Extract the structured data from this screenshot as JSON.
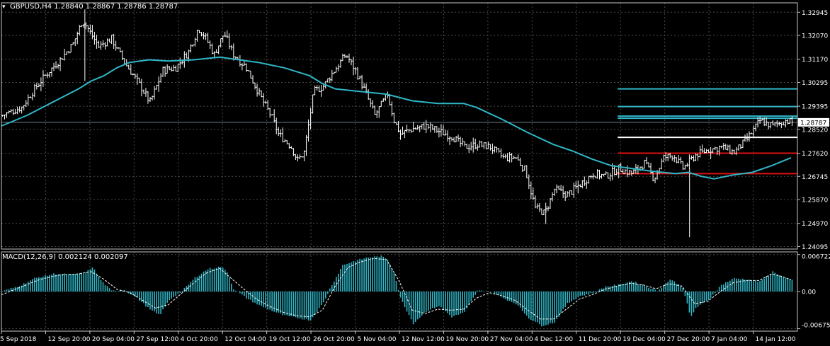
{
  "colors": {
    "background": "#000000",
    "grid": "#4a4a4a",
    "frame": "#c8c8c8",
    "price_bars": "#ffffff",
    "moving_average": "#2fb6c6",
    "macd_histogram": "#2fb6c6",
    "macd_signal": "#ffffff",
    "level_cyan": "#2fb6c6",
    "level_white": "#ffffff",
    "level_red": "#e01010",
    "current_price_line": "#708090",
    "text": "#ffffff"
  },
  "header": {
    "menu_glyph": "▾",
    "title": "GBPUSD,H4  1.28840 1.28867 1.28786 1.28787",
    "macd_title": "MACD(12,26,9) 0.002124 0.002097"
  },
  "chart_data": [
    {
      "type": "bar",
      "name": "GBPUSD,H4",
      "ylim": [
        1.24,
        1.333
      ],
      "y_ticks": [
        1.32945,
        1.3207,
        1.3117,
        1.30295,
        1.29395,
        1.2852,
        1.2762,
        1.26745,
        1.2587,
        1.2497,
        1.24095
      ],
      "y_tick_labels": [
        "1.32945",
        "1.32070",
        "1.31170",
        "1.30295",
        "1.29395",
        "1.28520",
        "1.27620",
        "1.26745",
        "1.25870",
        "1.24970",
        "1.24095"
      ],
      "last_price": 1.28787,
      "last_price_label": "1.28787",
      "x_labels": [
        "5 Sep 2018",
        "12 Sep 20:00",
        "20 Sep 04:00",
        "27 Sep 12:00",
        "4 Oct 20:00",
        "12 Oct 04:00",
        "19 Oct 12:00",
        "26 Oct 20:00",
        "5 Nov 04:00",
        "12 Nov 12:00",
        "19 Nov 20:00",
        "27 Nov 04:00",
        "4 Dec 12:00",
        "11 Dec 20:00",
        "19 Dec 04:00",
        "27 Dec 20:00",
        "7 Jan 04:00",
        "14 Jan 12:00"
      ],
      "close_path": [
        [
          0,
          1.2905
        ],
        [
          3,
          1.2935
        ],
        [
          5,
          1.3005
        ],
        [
          7,
          1.3065
        ],
        [
          9,
          1.3115
        ],
        [
          11,
          1.3175
        ],
        [
          12.5,
          1.3265
        ],
        [
          13,
          1.3245
        ],
        [
          15,
          1.3165
        ],
        [
          17,
          1.3195
        ],
        [
          19,
          1.3105
        ],
        [
          21,
          1.3035
        ],
        [
          23,
          1.2955
        ],
        [
          25,
          1.3075
        ],
        [
          27,
          1.3085
        ],
        [
          29,
          1.3145
        ],
        [
          30.5,
          1.3235
        ],
        [
          31.5,
          1.3205
        ],
        [
          33,
          1.3135
        ],
        [
          34.5,
          1.3215
        ],
        [
          36,
          1.3135
        ],
        [
          38,
          1.3085
        ],
        [
          40,
          1.2985
        ],
        [
          42,
          1.2895
        ],
        [
          43,
          1.2835
        ],
        [
          45,
          1.2785
        ],
        [
          46,
          1.2735
        ],
        [
          47,
          1.2765
        ],
        [
          48.5,
          1.2995
        ],
        [
          50,
          1.3015
        ],
        [
          52,
          1.3085
        ],
        [
          53.5,
          1.3135
        ],
        [
          55,
          1.3075
        ],
        [
          56.5,
          1.2995
        ],
        [
          58,
          1.2905
        ],
        [
          59,
          1.2945
        ],
        [
          60,
          1.2985
        ],
        [
          61,
          1.2885
        ],
        [
          62,
          1.2835
        ],
        [
          64,
          1.2855
        ],
        [
          66,
          1.2865
        ],
        [
          68,
          1.2845
        ],
        [
          70,
          1.2825
        ],
        [
          72,
          1.2785
        ],
        [
          74,
          1.2795
        ],
        [
          76,
          1.2785
        ],
        [
          78,
          1.2745
        ],
        [
          80,
          1.2745
        ],
        [
          81.5,
          1.2695
        ],
        [
          83,
          1.2555
        ],
        [
          84.5,
          1.2535
        ],
        [
          86,
          1.2625
        ],
        [
          88,
          1.2605
        ],
        [
          90,
          1.2645
        ],
        [
          92,
          1.2685
        ],
        [
          94,
          1.2675
        ],
        [
          96,
          1.2705
        ],
        [
          98,
          1.2685
        ],
        [
          100,
          1.2725
        ],
        [
          101.5,
          1.2665
        ],
        [
          103,
          1.2745
        ],
        [
          104.5,
          1.2755
        ],
        [
          106,
          1.2705
        ],
        [
          108,
          1.2755
        ],
        [
          110,
          1.2775
        ],
        [
          112,
          1.2785
        ],
        [
          114,
          1.2765
        ],
        [
          116,
          1.2815
        ],
        [
          118,
          1.2885
        ],
        [
          120,
          1.2865
        ],
        [
          122,
          1.2885
        ],
        [
          123,
          1.28787
        ]
      ],
      "ma_path": [
        [
          0,
          1.2865
        ],
        [
          4,
          1.2905
        ],
        [
          8,
          1.2955
        ],
        [
          12,
          1.3005
        ],
        [
          14,
          1.3035
        ],
        [
          16,
          1.3055
        ],
        [
          18,
          1.3085
        ],
        [
          20,
          1.3105
        ],
        [
          23,
          1.3115
        ],
        [
          26,
          1.311
        ],
        [
          30,
          1.3115
        ],
        [
          34,
          1.3125
        ],
        [
          37,
          1.3115
        ],
        [
          40,
          1.3105
        ],
        [
          44,
          1.3085
        ],
        [
          48,
          1.3055
        ],
        [
          50,
          1.3025
        ],
        [
          52,
          1.3005
        ],
        [
          56,
          1.2995
        ],
        [
          60,
          1.2985
        ],
        [
          64,
          1.296
        ],
        [
          68,
          1.295
        ],
        [
          72,
          1.295
        ],
        [
          74,
          1.2935
        ],
        [
          78,
          1.289
        ],
        [
          82,
          1.284
        ],
        [
          86,
          1.2795
        ],
        [
          89,
          1.277
        ],
        [
          92,
          1.274
        ],
        [
          95,
          1.2715
        ],
        [
          98,
          1.2705
        ],
        [
          101,
          1.2695
        ],
        [
          103,
          1.269
        ],
        [
          105,
          1.2685
        ],
        [
          107,
          1.269
        ],
        [
          109,
          1.2675
        ],
        [
          111,
          1.2665
        ],
        [
          114,
          1.268
        ],
        [
          117,
          1.269
        ],
        [
          120,
          1.2715
        ],
        [
          123,
          1.2745
        ]
      ],
      "levels": [
        {
          "price": 1.3005,
          "color": "#2fb6c6",
          "x_start": 96
        },
        {
          "price": 1.2938,
          "color": "#2fb6c6",
          "x_start": 96
        },
        {
          "price": 1.2902,
          "color": "#2fb6c6",
          "x_start": 96
        },
        {
          "price": 1.2894,
          "color": "#2fb6c6",
          "x_start": 96
        },
        {
          "price": 1.2822,
          "color": "#ffffff",
          "x_start": 96
        },
        {
          "price": 1.2762,
          "color": "#e01010",
          "x_start": 96
        },
        {
          "price": 1.2685,
          "color": "#e01010",
          "x_start": 96
        }
      ],
      "spikes": [
        {
          "x": 13,
          "high": 1.3305,
          "low": 1.3035
        },
        {
          "x": 107.2,
          "high": 1.2705,
          "low": 1.2445
        },
        {
          "x": 84.8,
          "high": 1.2575,
          "low": 1.2495
        }
      ]
    },
    {
      "type": "bar",
      "name": "MACD(12,26,9)",
      "ylim": [
        -0.0072,
        0.0072
      ],
      "y_ticks": [
        0.006722,
        0.0,
        -0.006756
      ],
      "y_tick_labels": [
        "0.006722",
        "0.00",
        "-0.006756"
      ],
      "macd_path": [
        [
          0,
          0.0
        ],
        [
          3,
          0.0012
        ],
        [
          5,
          0.0024
        ],
        [
          8,
          0.0032
        ],
        [
          11,
          0.0031
        ],
        [
          13,
          0.0034
        ],
        [
          14,
          0.0045
        ],
        [
          15.5,
          0.0018
        ],
        [
          17,
          0.0001
        ],
        [
          19,
          0.0003
        ],
        [
          21,
          -0.0012
        ],
        [
          23,
          -0.0033
        ],
        [
          24.5,
          -0.0043
        ],
        [
          26,
          -0.0015
        ],
        [
          28,
          0.0001
        ],
        [
          30,
          0.0025
        ],
        [
          32,
          0.0041
        ],
        [
          34,
          0.0045
        ],
        [
          35,
          0.0036
        ],
        [
          36,
          0.0005
        ],
        [
          38,
          -0.0012
        ],
        [
          40,
          -0.0025
        ],
        [
          42,
          -0.0035
        ],
        [
          44,
          -0.0044
        ],
        [
          46,
          -0.0048
        ],
        [
          48,
          -0.0052
        ],
        [
          50,
          -0.002
        ],
        [
          51,
          0.0005
        ],
        [
          53,
          0.0048
        ],
        [
          55,
          0.0056
        ],
        [
          57,
          0.0062
        ],
        [
          59,
          0.0064
        ],
        [
          60,
          0.0058
        ],
        [
          61,
          0.0035
        ],
        [
          62,
          -0.0012
        ],
        [
          63,
          -0.0035
        ],
        [
          64,
          -0.0058
        ],
        [
          66,
          -0.0036
        ],
        [
          68,
          -0.0026
        ],
        [
          70,
          -0.0046
        ],
        [
          72,
          -0.0038
        ],
        [
          74,
          0.0001
        ],
        [
          76,
          0.0001
        ],
        [
          78,
          -0.0012
        ],
        [
          80,
          -0.0022
        ],
        [
          82,
          -0.0048
        ],
        [
          84,
          -0.0062
        ],
        [
          86,
          -0.0056
        ],
        [
          88,
          -0.0022
        ],
        [
          90,
          -0.0008
        ],
        [
          92,
          -0.0003
        ],
        [
          94,
          0.0009
        ],
        [
          96,
          0.0012
        ],
        [
          98,
          0.0019
        ],
        [
          100,
          0.0011
        ],
        [
          102,
          0.0001
        ],
        [
          104,
          0.0022
        ],
        [
          106,
          0.0008
        ],
        [
          107.2,
          -0.0048
        ],
        [
          108,
          -0.003
        ],
        [
          110,
          -0.0015
        ],
        [
          112,
          0.0012
        ],
        [
          114,
          0.0024
        ],
        [
          116,
          0.0022
        ],
        [
          118,
          0.0018
        ],
        [
          120,
          0.0036
        ],
        [
          122,
          0.0024
        ],
        [
          123,
          0.0021
        ]
      ],
      "signal_path": [
        [
          0,
          -0.0006
        ],
        [
          3,
          0.0008
        ],
        [
          6,
          0.0022
        ],
        [
          9,
          0.003
        ],
        [
          12,
          0.0032
        ],
        [
          14,
          0.0036
        ],
        [
          16,
          0.0022
        ],
        [
          18,
          0.0004
        ],
        [
          20,
          -0.0002
        ],
        [
          22,
          -0.0016
        ],
        [
          24,
          -0.003
        ],
        [
          26,
          -0.0024
        ],
        [
          28,
          -0.0004
        ],
        [
          30,
          0.0016
        ],
        [
          32,
          0.0034
        ],
        [
          34,
          0.0042
        ],
        [
          36,
          0.0022
        ],
        [
          38,
          0.0002
        ],
        [
          40,
          -0.0016
        ],
        [
          42,
          -0.0028
        ],
        [
          44,
          -0.0038
        ],
        [
          46,
          -0.0044
        ],
        [
          48,
          -0.0046
        ],
        [
          50,
          -0.0034
        ],
        [
          52,
          0.001
        ],
        [
          54,
          0.0044
        ],
        [
          56,
          0.0054
        ],
        [
          58,
          0.006
        ],
        [
          60,
          0.0058
        ],
        [
          62,
          0.0018
        ],
        [
          64,
          -0.0034
        ],
        [
          66,
          -0.004
        ],
        [
          68,
          -0.0032
        ],
        [
          70,
          -0.0034
        ],
        [
          72,
          -0.0032
        ],
        [
          74,
          -0.0012
        ],
        [
          76,
          -0.0002
        ],
        [
          78,
          -0.0008
        ],
        [
          80,
          -0.0016
        ],
        [
          82,
          -0.0034
        ],
        [
          84,
          -0.005
        ],
        [
          86,
          -0.005
        ],
        [
          88,
          -0.0032
        ],
        [
          90,
          -0.0014
        ],
        [
          92,
          -0.0006
        ],
        [
          94,
          0.0004
        ],
        [
          96,
          0.001
        ],
        [
          98,
          0.0015
        ],
        [
          100,
          0.0012
        ],
        [
          102,
          0.0005
        ],
        [
          104,
          0.0014
        ],
        [
          106,
          0.001
        ],
        [
          108,
          -0.0022
        ],
        [
          110,
          -0.0018
        ],
        [
          112,
          0.0
        ],
        [
          114,
          0.0016
        ],
        [
          116,
          0.002
        ],
        [
          118,
          0.002
        ],
        [
          120,
          0.0032
        ],
        [
          122,
          0.0026
        ],
        [
          123,
          0.0021
        ]
      ]
    }
  ]
}
